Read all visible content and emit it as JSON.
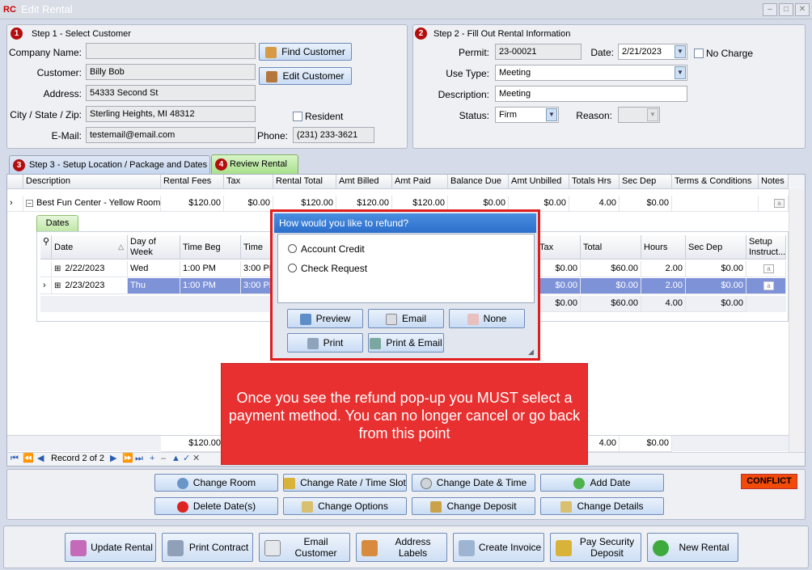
{
  "window": {
    "title": "Edit Rental",
    "app_icon": "RC"
  },
  "step1": {
    "badge": "1",
    "title": "Step 1 - Select Customer",
    "company_label": "Company Name:",
    "company_value": "",
    "customer_label": "Customer:",
    "customer_value": "Billy Bob",
    "address_label": "Address:",
    "address_value": "54333 Second St",
    "city_label": "City / State / Zip:",
    "city_value": "Sterling Heights, MI 48312",
    "email_label": "E-Mail:",
    "email_value": "testemail@email.com",
    "phone_label": "Phone:",
    "phone_value": "(231) 233-3621",
    "resident_label": "Resident",
    "find_customer": "Find Customer",
    "edit_customer": "Edit Customer"
  },
  "step2": {
    "badge": "2",
    "title": "Step 2 - Fill Out Rental Information",
    "permit_label": "Permit:",
    "permit_value": "23-00021",
    "date_label": "Date:",
    "date_value": "2/21/2023",
    "no_charge_label": "No Charge",
    "use_type_label": "Use Type:",
    "use_type_value": "Meeting",
    "description_label": "Description:",
    "description_value": "Meeting",
    "status_label": "Status:",
    "status_value": "Firm",
    "reason_label": "Reason:",
    "reason_value": ""
  },
  "tabs": [
    {
      "badge": "3",
      "label": "Step 3 - Setup Location / Package and Dates"
    },
    {
      "badge": "4",
      "label": "Review Rental"
    }
  ],
  "grid": {
    "headers": [
      "Description",
      "Rental Fees",
      "Tax",
      "Rental Total",
      "Amt Billed",
      "Amt Paid",
      "Balance Due",
      "Amt Unbilled",
      "Totals Hrs",
      "Sec Dep",
      "Terms & Conditions",
      "Notes"
    ],
    "row": [
      "Best Fun Center - Yellow Room",
      "$120.00",
      "$0.00",
      "$120.00",
      "$120.00",
      "$120.00",
      "$0.00",
      "$0.00",
      "4.00",
      "$0.00"
    ],
    "footer": {
      "rental_fees": "$120.00",
      "hours": "4.00",
      "sec_dep": "$0.00"
    },
    "record_nav": "Record 2 of 2"
  },
  "dates": {
    "tab_label": "Dates",
    "headers": [
      "Date",
      "Day of Week",
      "Time Beg",
      "Time End",
      "Tax",
      "Total",
      "Hours",
      "Sec Dep",
      "Setup Instruct..."
    ],
    "rows": [
      {
        "date": "2/22/2023",
        "day": "Wed",
        "time_beg": "1:00 PM",
        "time_end": "3:00 PM",
        "tax": "$0.00",
        "total": "$60.00",
        "hours": "2.00",
        "sec_dep": "$0.00"
      },
      {
        "date": "2/23/2023",
        "day": "Thu",
        "time_beg": "1:00 PM",
        "time_end": "3:00 PM",
        "tax": "$0.00",
        "total": "$0.00",
        "hours": "2.00",
        "sec_dep": "$0.00"
      }
    ],
    "footer": {
      "tax": "$0.00",
      "total": "$60.00",
      "hours": "4.00",
      "sec_dep": "$0.00"
    }
  },
  "dialog": {
    "title": "How would you like to refund?",
    "options": [
      "Account Credit",
      "Check Request"
    ],
    "buttons": [
      "Preview",
      "Email",
      "None",
      "Print",
      "Print & Email"
    ]
  },
  "callout": {
    "text": "Once you see the refund pop-up you MUST select a payment method.  You can no longer cancel or go back from this point"
  },
  "actions": {
    "change_room": "Change Room",
    "change_rate": "Change Rate / Time Slot",
    "change_date_time": "Change Date & Time",
    "add_date": "Add Date",
    "delete_dates": "Delete Date(s)",
    "change_options": "Change Options",
    "change_deposit": "Change Deposit",
    "change_details": "Change Details",
    "conflict": "CONFLICT"
  },
  "bottom": {
    "update_rental": "Update Rental",
    "print_contract": "Print Contract",
    "email_customer": "Email Customer",
    "address_labels": "Address Labels",
    "create_invoice": "Create Invoice",
    "pay_security_deposit": "Pay Security Deposit",
    "new_rental": "New Rental"
  },
  "colors": {
    "accent_red": "#e01e1e",
    "conflict": "#f24a08",
    "selected_row": "#7e92d8",
    "callout_bg": "#e83030"
  }
}
